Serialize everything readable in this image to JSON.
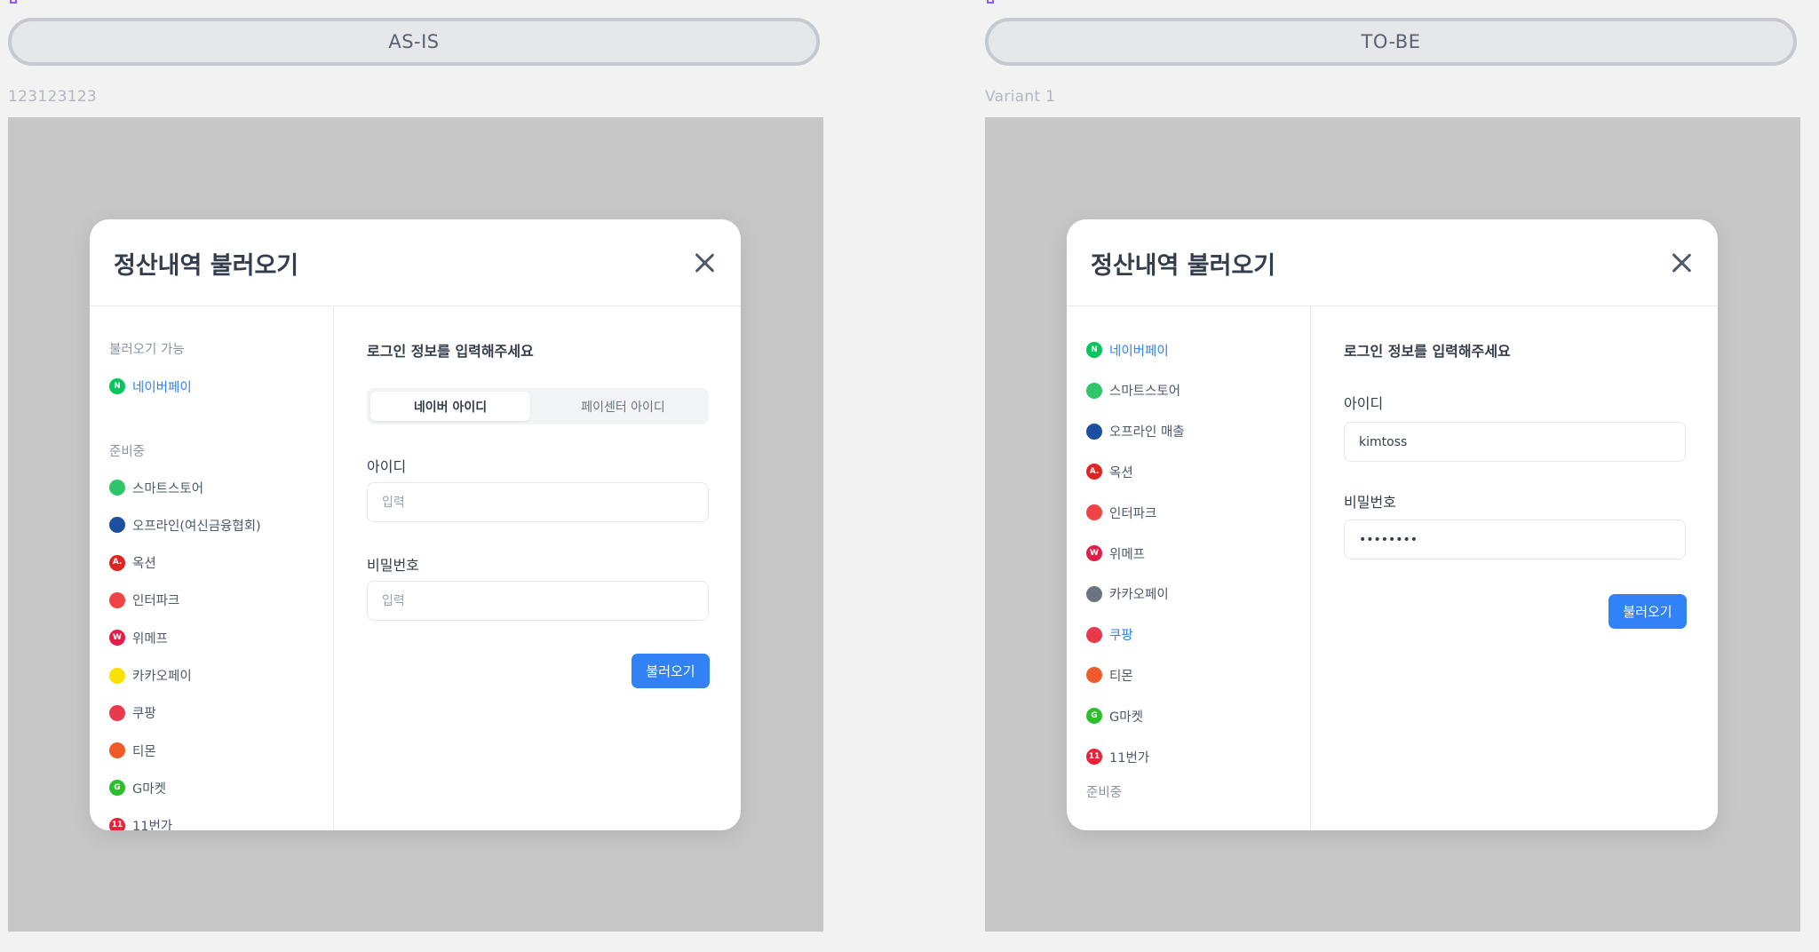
{
  "colors": {
    "accent": "#3182f6",
    "canvas": "#c7c7c8",
    "text_primary": "#333d4b",
    "text_muted": "#8b95a1"
  },
  "as_is": {
    "header_label": "AS-IS",
    "variant_label": "123123123",
    "modal": {
      "title": "정산내역 불러오기",
      "sidebar": {
        "available_label": "불러오기 가능",
        "available_items": [
          {
            "label": "네이버페이",
            "icon": "naverpay-icon",
            "icon_color": "#03c75a",
            "icon_text": "N",
            "active": true
          }
        ],
        "preparing_label": "준비중",
        "preparing_items": [
          {
            "label": "스마트스토어",
            "icon": "smartstore-icon",
            "icon_color": "#2fc56a",
            "icon_text": ""
          },
          {
            "label": "오프라인(여신금융협회)",
            "icon": "offline-icon",
            "icon_color": "#1b4fa0",
            "icon_text": ""
          },
          {
            "label": "옥션",
            "icon": "auction-icon",
            "icon_color": "#e02424",
            "icon_text": "A."
          },
          {
            "label": "인터파크",
            "icon": "interpark-icon",
            "icon_color": "#ef4444",
            "icon_text": ""
          },
          {
            "label": "위메프",
            "icon": "wemakeprice-icon",
            "icon_color": "#e11d48",
            "icon_text": "W"
          },
          {
            "label": "카카오페이",
            "icon": "kakaopay-icon",
            "icon_color": "#fae100",
            "icon_text": ""
          },
          {
            "label": "쿠팡",
            "icon": "coupang-icon",
            "icon_color": "#e9394d",
            "icon_text": ""
          },
          {
            "label": "티몬",
            "icon": "tmon-icon",
            "icon_color": "#f05a28",
            "icon_text": ""
          },
          {
            "label": "G마켓",
            "icon": "gmarket-icon",
            "icon_color": "#2bc02b",
            "icon_text": "G"
          },
          {
            "label": "11번가",
            "icon": "11st-icon",
            "icon_color": "#e8223a",
            "icon_text": "11"
          }
        ]
      },
      "main": {
        "heading": "로그인 정보를 입력해주세요",
        "tabs": [
          {
            "label": "네이버 아이디",
            "selected": true
          },
          {
            "label": "페이센터 아이디",
            "selected": false
          }
        ],
        "id_label": "아이디",
        "id_placeholder": "입력",
        "id_value": "",
        "password_label": "비밀번호",
        "password_placeholder": "입력",
        "password_value": "",
        "submit_label": "불러오기"
      }
    }
  },
  "to_be": {
    "header_label": "TO-BE",
    "variant_label": "Variant 1",
    "modal": {
      "title": "정산내역 불러오기",
      "sidebar": {
        "items": [
          {
            "label": "네이버페이",
            "icon": "naverpay-icon",
            "icon_color": "#03c75a",
            "icon_text": "N",
            "active": true
          },
          {
            "label": "스마트스토어",
            "icon": "smartstore-icon",
            "icon_color": "#2fc56a",
            "icon_text": ""
          },
          {
            "label": "오프라인 매출",
            "icon": "offline-icon",
            "icon_color": "#1b4fa0",
            "icon_text": ""
          },
          {
            "label": "옥션",
            "icon": "auction-icon",
            "icon_color": "#e02424",
            "icon_text": "A."
          },
          {
            "label": "인터파크",
            "icon": "interpark-icon",
            "icon_color": "#ef4444",
            "icon_text": ""
          },
          {
            "label": "위메프",
            "icon": "wemakeprice-icon",
            "icon_color": "#e11d48",
            "icon_text": "W"
          },
          {
            "label": "카카오페이",
            "icon": "kakaopay-icon",
            "icon_color": "#6b7280",
            "icon_text": ""
          },
          {
            "label": "쿠팡",
            "icon": "coupang-icon",
            "icon_color": "#e9394d",
            "icon_text": "",
            "active": true
          },
          {
            "label": "티몬",
            "icon": "tmon-icon",
            "icon_color": "#f05a28",
            "icon_text": ""
          },
          {
            "label": "G마켓",
            "icon": "gmarket-icon",
            "icon_color": "#2bc02b",
            "icon_text": "G"
          },
          {
            "label": "11번가",
            "icon": "11st-icon",
            "icon_color": "#e8223a",
            "icon_text": "11"
          }
        ],
        "preparing_label": "준비중"
      },
      "main": {
        "heading": "로그인 정보를 입력해주세요",
        "id_label": "아이디",
        "id_value": "kimtoss",
        "password_label": "비밀번호",
        "password_value": "********",
        "submit_label": "불러오기"
      }
    }
  }
}
